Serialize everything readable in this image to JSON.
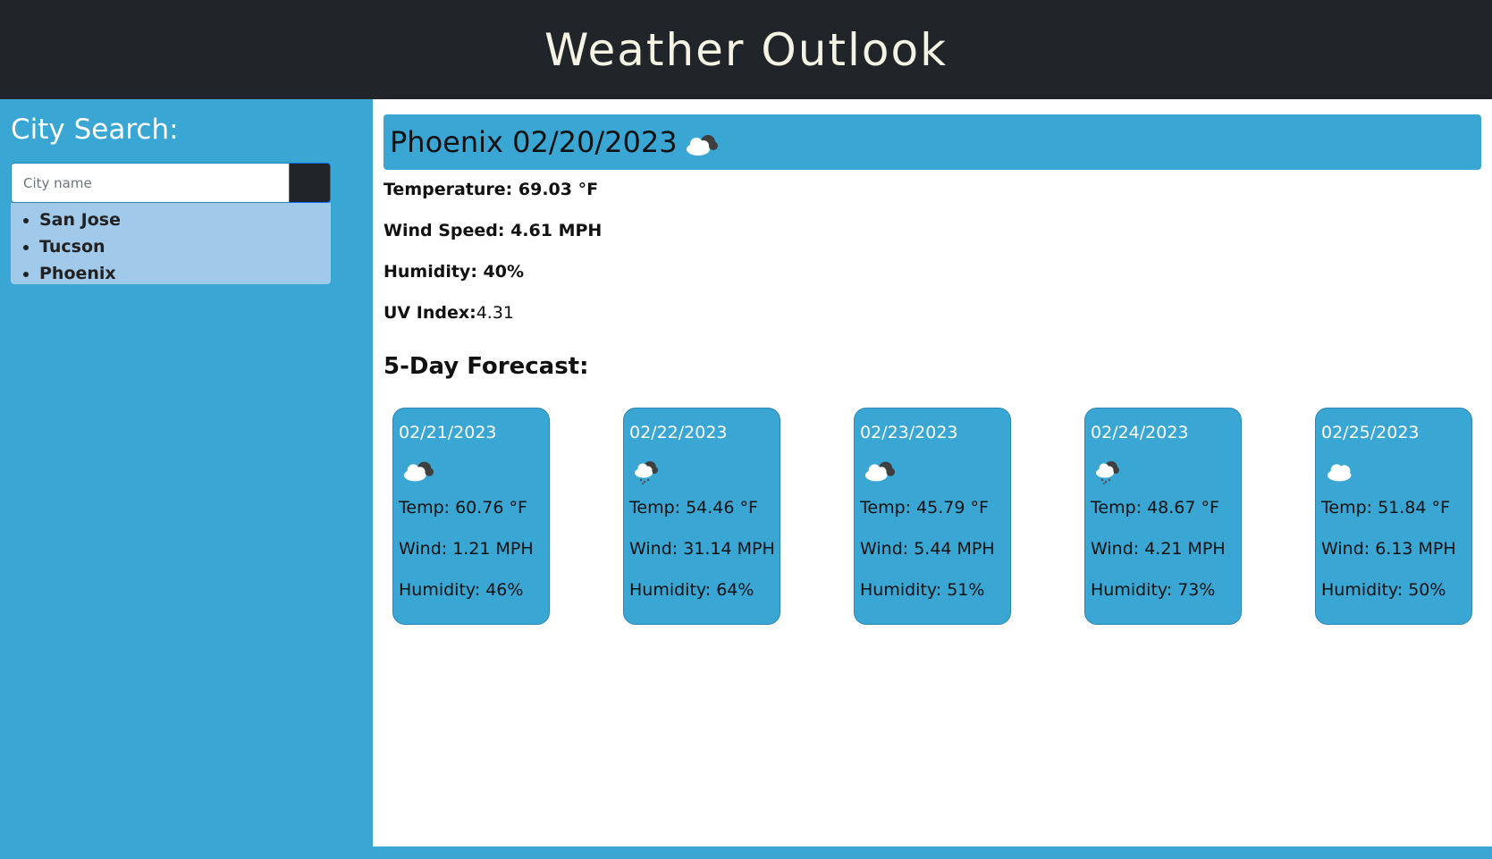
{
  "header": {
    "title": "Weather Outlook"
  },
  "sidebar": {
    "heading": "City Search:",
    "search_placeholder": "City name",
    "history": [
      "San Jose",
      "Tucson",
      "Phoenix"
    ]
  },
  "current": {
    "title": "Phoenix 02/20/2023",
    "icon": "cloud-icon",
    "temperature": "Temperature: 69.03 °F",
    "wind": "Wind Speed: 4.61 MPH",
    "humidity": "Humidity: 40%",
    "uv_label": "UV Index:",
    "uv_value": "4.31"
  },
  "forecast": {
    "title": "5-Day Forecast:",
    "days": [
      {
        "date": "02/21/2023",
        "icon": "cloud-icon",
        "temp": "Temp: 60.76 °F",
        "wind": "Wind: 1.21 MPH",
        "humidity": "Humidity: 46%"
      },
      {
        "date": "02/22/2023",
        "icon": "rain-cloud-icon",
        "temp": "Temp: 54.46 °F",
        "wind": "Wind: 31.14 MPH",
        "humidity": "Humidity: 64%"
      },
      {
        "date": "02/23/2023",
        "icon": "cloud-icon",
        "temp": "Temp: 45.79 °F",
        "wind": "Wind: 5.44 MPH",
        "humidity": "Humidity: 51%"
      },
      {
        "date": "02/24/2023",
        "icon": "rain-cloud-icon",
        "temp": "Temp: 48.67 °F",
        "wind": "Wind: 4.21 MPH",
        "humidity": "Humidity: 73%"
      },
      {
        "date": "02/25/2023",
        "icon": "cloud-icon",
        "temp": "Temp: 51.84 °F",
        "wind": "Wind: 6.13 MPH",
        "humidity": "Humidity: 50%"
      }
    ]
  },
  "colors": {
    "header_bg": "#212429",
    "header_text": "#f5f3e4",
    "accent": "#3aa6d4",
    "history_bg": "#a0c9ea"
  }
}
